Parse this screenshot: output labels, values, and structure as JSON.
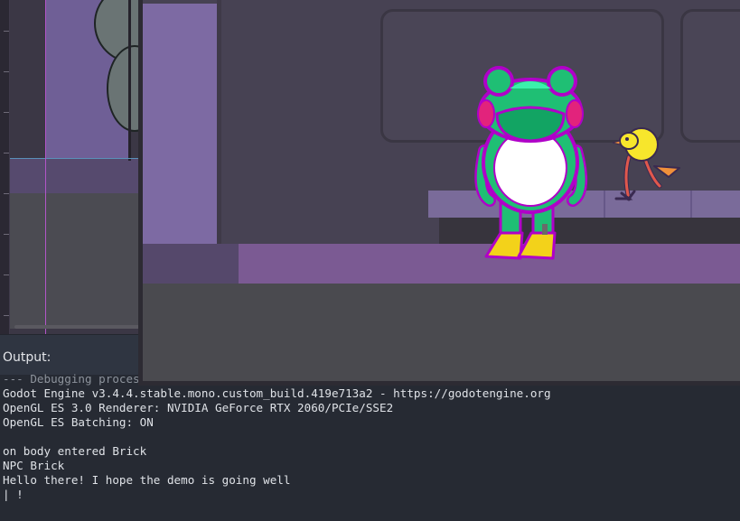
{
  "output": {
    "title": "Output:",
    "lines": [
      "--- Debugging process started ---",
      "Godot Engine v3.4.4.stable.mono.custom_build.419e713a2 - https://godotengine.org",
      "OpenGL ES 3.0 Renderer: NVIDIA GeForce RTX 2060/PCIe/SSE2",
      "OpenGL ES Batching: ON",
      "",
      "on body entered Brick",
      "NPC Brick",
      "Hello there! I hope the demo is going well",
      "| !"
    ]
  },
  "game": {
    "player_icon": "frog-character",
    "npc_icon": "yellow-bird-npc"
  },
  "colors": {
    "player_body": "#1fbf74",
    "player_outline": "#b000c8",
    "player_boots": "#f3d21a",
    "npc_body": "#f7e62c",
    "floor": "#7b5a93",
    "output_background": "#262a33"
  }
}
